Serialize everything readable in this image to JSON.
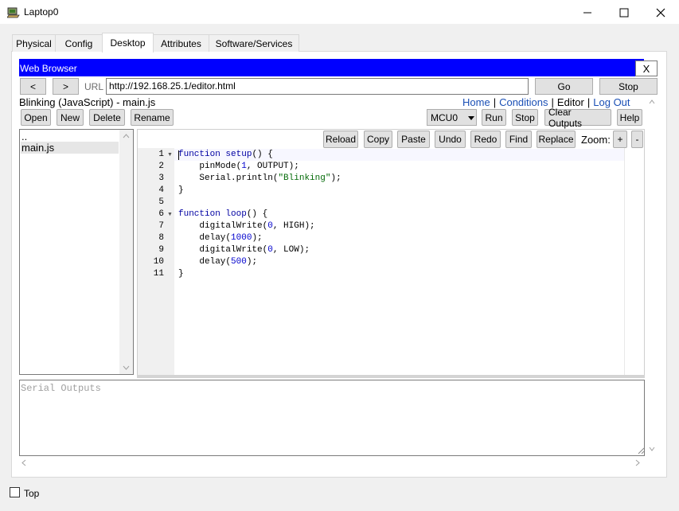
{
  "window": {
    "title": "Laptop0",
    "controls": {
      "minimize": "—",
      "maximize": "☐",
      "close": "✕"
    }
  },
  "tabs": [
    {
      "label": "Physical"
    },
    {
      "label": "Config"
    },
    {
      "label": "Desktop",
      "active": true
    },
    {
      "label": "Attributes"
    },
    {
      "label": "Software/Services"
    }
  ],
  "browser": {
    "title": "Web Browser",
    "close_label": "X",
    "back_label": "<",
    "forward_label": ">",
    "url_label": "URL",
    "url_value": "http://192.168.25.1/editor.html",
    "go_label": "Go",
    "stop_label": "Stop"
  },
  "page": {
    "heading": "Blinking (JavaScript) - main.js",
    "nav": {
      "home": "Home",
      "conditions": "Conditions",
      "editor": "Editor",
      "logout": "Log Out",
      "sep": "|"
    },
    "file_buttons": [
      "Open",
      "New",
      "Delete",
      "Rename"
    ],
    "mcu_selected": "MCU0",
    "run_label": "Run",
    "stop_label": "Stop",
    "clear_label": "Clear Outputs",
    "help_label": "Help",
    "editor_buttons": [
      "Reload",
      "Copy",
      "Paste",
      "Undo",
      "Redo",
      "Find",
      "Replace"
    ],
    "zoom_label": "Zoom:",
    "zoom_in": "+",
    "zoom_out": "-",
    "files": [
      "..",
      "main.js"
    ],
    "serial_placeholder": "Serial Outputs"
  },
  "code_lines": [
    "function setup() {",
    "    pinMode(1, OUTPUT);",
    "    Serial.println(\"Blinking\");",
    "}",
    "",
    "function loop() {",
    "    digitalWrite(0, HIGH);",
    "    delay(1000);",
    "    digitalWrite(0, LOW);",
    "    delay(500);",
    "}"
  ],
  "line_numbers": [
    "1",
    "2",
    "3",
    "4",
    "5",
    "6",
    "7",
    "8",
    "9",
    "10",
    "11"
  ],
  "bottom": {
    "top_label": "Top"
  },
  "colors": {
    "browser_title_bg": "#0000ff",
    "link": "#1a4fb5",
    "keyword": "#0000a2",
    "string": "#036a07"
  }
}
